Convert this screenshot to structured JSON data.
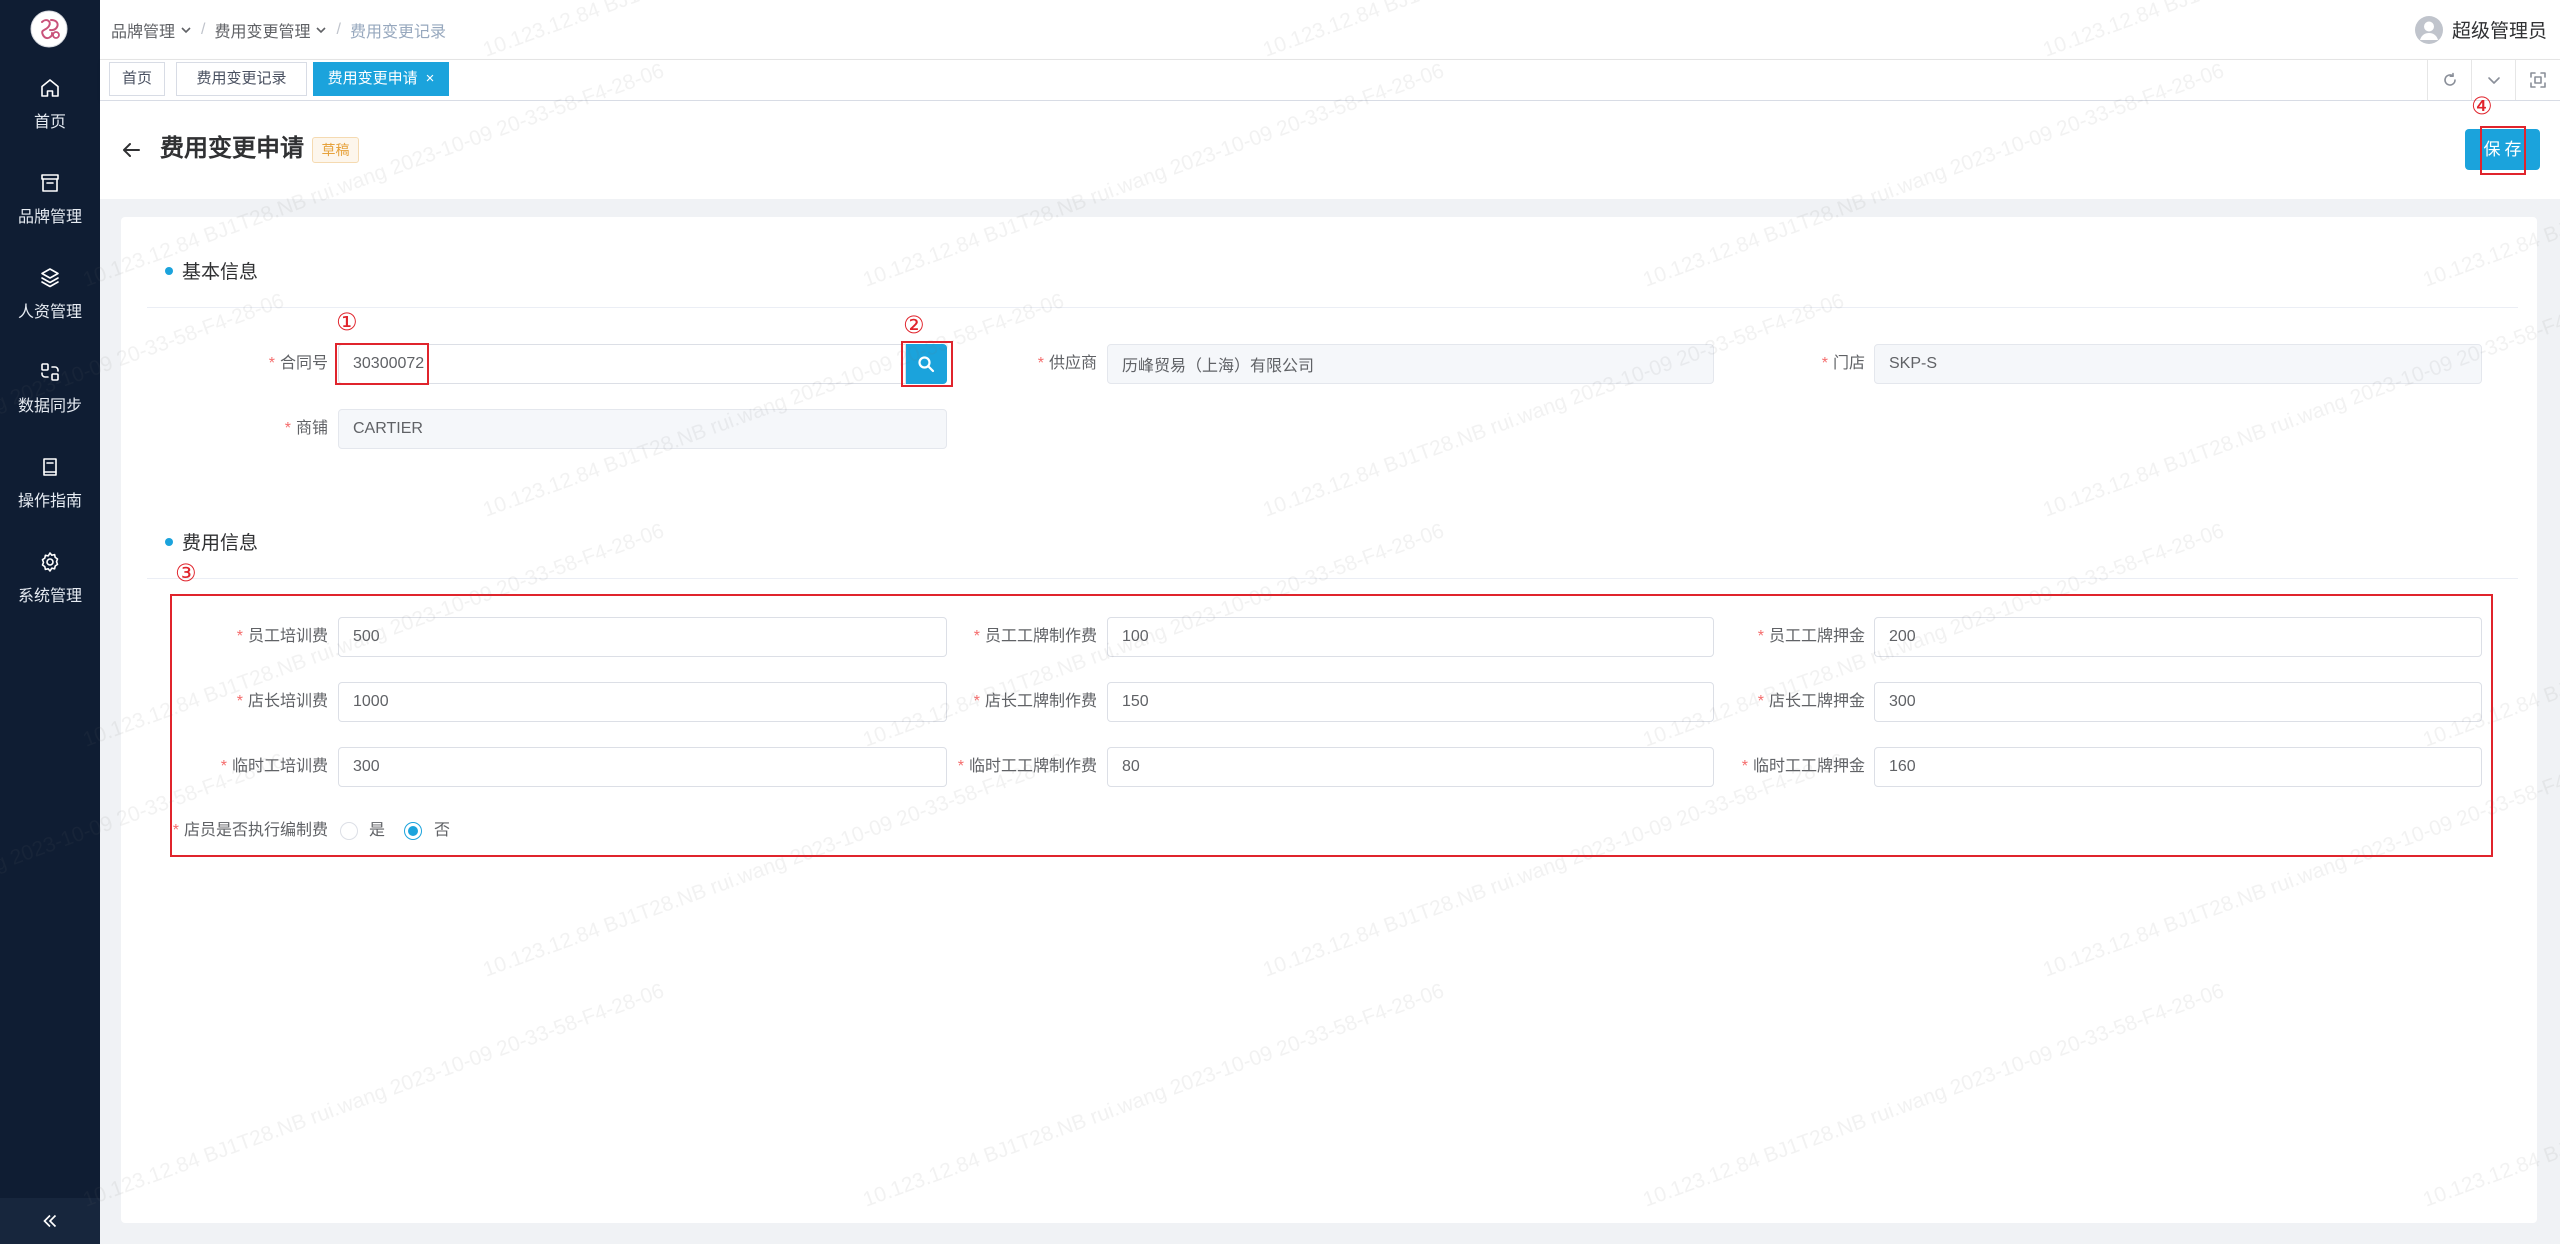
{
  "colors": {
    "accent": "#1ba3dc",
    "sidebar": "#0f1d33",
    "annotation": "#e0242c",
    "required": "#f56c6c",
    "draft_badge": "#e6a23c"
  },
  "sidebar": {
    "logo_icon": "skp-logo-icon",
    "items": [
      {
        "label": "首页",
        "icon": "home-icon"
      },
      {
        "label": "品牌管理",
        "icon": "archive-icon"
      },
      {
        "label": "人资管理",
        "icon": "layers-icon"
      },
      {
        "label": "数据同步",
        "icon": "data-sync-icon"
      },
      {
        "label": "操作指南",
        "icon": "book-icon"
      },
      {
        "label": "系统管理",
        "icon": "gear-icon"
      }
    ],
    "collapse_icon": "double-chevron-left-icon"
  },
  "header": {
    "breadcrumb": [
      {
        "label": "品牌管理",
        "has_dropdown": true
      },
      {
        "label": "费用变更管理",
        "has_dropdown": true
      },
      {
        "label": "费用变更记录",
        "has_dropdown": false
      }
    ],
    "separator": "/",
    "user_icon": "user-avatar-icon",
    "user_name": "超级管理员"
  },
  "tabs": {
    "items": [
      {
        "label": "首页",
        "active": false
      },
      {
        "label": "费用变更记录",
        "active": false
      },
      {
        "label": "费用变更申请",
        "active": true
      }
    ],
    "close_symbol": "×",
    "tools": [
      "refresh-icon",
      "chevron-down-icon",
      "fullscreen-icon"
    ]
  },
  "page": {
    "back_icon": "arrow-left-icon",
    "title": "费用变更申请",
    "status": "草稿",
    "save_label": "保存"
  },
  "required_mark": "*",
  "basic": {
    "section_title": "基本信息",
    "contract": {
      "label": "合同号",
      "value": "30300072",
      "search_icon": "search-icon"
    },
    "supplier": {
      "label": "供应商",
      "value": "历峰贸易（上海）有限公司"
    },
    "store": {
      "label": "门店",
      "value": "SKP-S"
    },
    "shop": {
      "label": "商铺",
      "value": "CARTIER"
    }
  },
  "fees": {
    "section_title": "费用信息",
    "rows": [
      [
        {
          "label": "员工培训费",
          "value": "500"
        },
        {
          "label": "员工工牌制作费",
          "value": "100"
        },
        {
          "label": "员工工牌押金",
          "value": "200"
        }
      ],
      [
        {
          "label": "店长培训费",
          "value": "1000"
        },
        {
          "label": "店长工牌制作费",
          "value": "150"
        },
        {
          "label": "店长工牌押金",
          "value": "300"
        }
      ],
      [
        {
          "label": "临时工培训费",
          "value": "300"
        },
        {
          "label": "临时工工牌制作费",
          "value": "80"
        },
        {
          "label": "临时工工牌押金",
          "value": "160"
        }
      ]
    ],
    "headcount_fee": {
      "label": "店员是否执行编制费",
      "options": [
        "是",
        "否"
      ],
      "selected": "否"
    }
  },
  "annotations": [
    "①",
    "②",
    "③",
    "④"
  ],
  "watermark": "10.123.12.84  BJ1T28.NB  rui.wang  2023-10-09  20-33-58-F4-28-06"
}
